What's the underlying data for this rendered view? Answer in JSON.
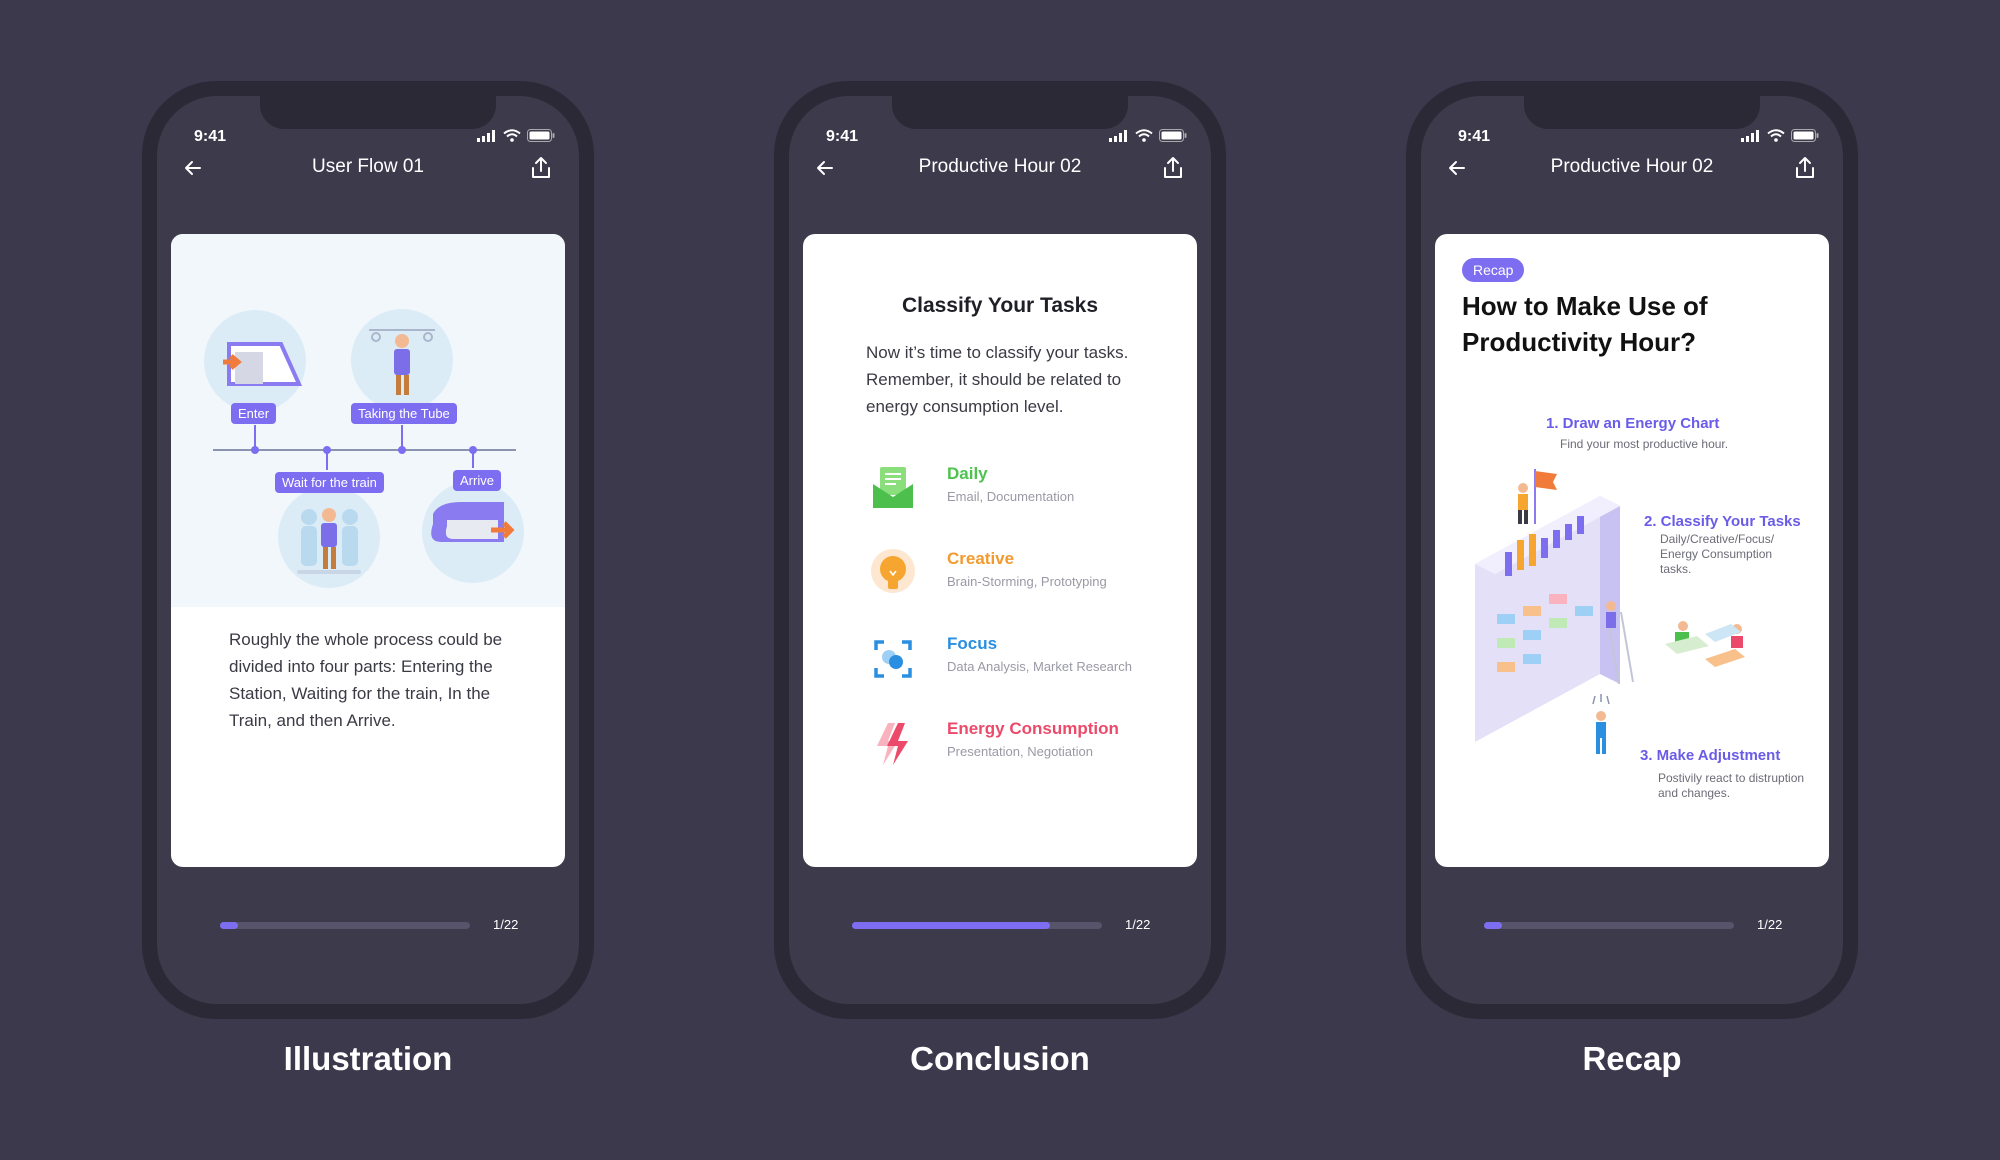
{
  "status": {
    "time": "9:41"
  },
  "phones": [
    {
      "title": "User Flow 01",
      "progress": {
        "value": 0.07,
        "label": "1/22"
      },
      "caption": "Illustration",
      "tags": {
        "enter": "Enter",
        "tube": "Taking the Tube",
        "wait": "Wait for the train",
        "arrive": "Arrive"
      },
      "description": "Roughly the whole process could be divided into four parts: Entering the Station, Waiting for the train, In the Train, and then Arrive."
    },
    {
      "title": "Productive Hour 02",
      "progress": {
        "value": 0.79,
        "label": "1/22"
      },
      "caption": "Conclusion",
      "heading": "Classify Your Tasks",
      "body": "Now it’s time to classify your tasks. Remember, it should be related to energy consumption level.",
      "tasks": [
        {
          "name": "Daily",
          "sub": "Email, Documentation",
          "color": "#4fc24f",
          "icon": "envelope-document-icon"
        },
        {
          "name": "Creative",
          "sub": "Brain-Storming, Prototyping",
          "color": "#f29a2e",
          "icon": "lightbulb-icon"
        },
        {
          "name": "Focus",
          "sub": "Data Analysis, Market Research",
          "color": "#2a8fe0",
          "icon": "focus-target-icon"
        },
        {
          "name": "Energy Consumption",
          "sub": "Presentation, Negotiation",
          "color": "#ec4a6a",
          "icon": "lightning-icon"
        }
      ]
    },
    {
      "title": "Productive Hour 02",
      "progress": {
        "value": 0.07,
        "label": "1/22"
      },
      "caption": "Recap",
      "pill": "Recap",
      "heading": "How to Make Use of Productivity Hour?",
      "steps": [
        {
          "title": "1. Draw an Energy Chart",
          "sub": "Find your most productive hour."
        },
        {
          "title": "2. Classify Your Tasks",
          "sub": "Daily/Creative/Focus/ Energy Consumption tasks."
        },
        {
          "title": "3. Make Adjustment",
          "sub": "Postivily react to distruption and changes."
        }
      ]
    }
  ]
}
